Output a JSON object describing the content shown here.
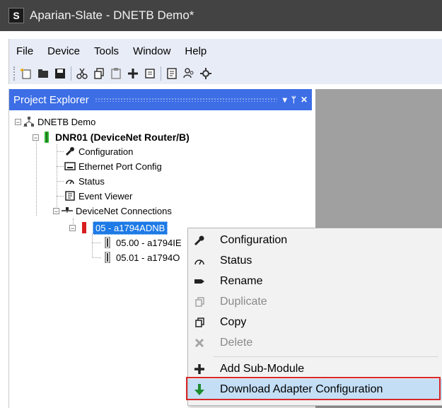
{
  "window": {
    "title": "Aparian-Slate  - DNETB Demo*",
    "icon_letter": "S"
  },
  "menubar": {
    "items": [
      "File",
      "Device",
      "Tools",
      "Window",
      "Help"
    ]
  },
  "toolbar": {
    "icons": [
      "new-file-icon",
      "open-folder-icon",
      "save-icon",
      "cut-icon",
      "copy-icon",
      "paste-icon",
      "add-icon",
      "download-icon",
      "event-icon",
      "users-icon",
      "settings-icon"
    ]
  },
  "explorer": {
    "title": "Project Explorer",
    "pin_glyph": "▾ ᛘ ✕",
    "tree": {
      "root": "DNETB Demo",
      "device": "DNR01 (DeviceNet Router/B)",
      "children": [
        "Configuration",
        "Ethernet Port Config",
        "Status",
        "Event Viewer",
        "DeviceNet Connections"
      ],
      "adapter": "05 - a1794ADNB",
      "modules": [
        "05.00 - a1794IE",
        "05.01 - a1794O"
      ]
    }
  },
  "context_menu": {
    "items": [
      {
        "label": "Configuration",
        "icon": "wrench-icon",
        "disabled": false
      },
      {
        "label": "Status",
        "icon": "status-icon",
        "disabled": false
      },
      {
        "label": "Rename",
        "icon": "rename-icon",
        "disabled": false
      },
      {
        "label": "Duplicate",
        "icon": "duplicate-icon",
        "disabled": true
      },
      {
        "label": "Copy",
        "icon": "copy-icon",
        "disabled": false
      },
      {
        "label": "Delete",
        "icon": "delete-icon",
        "disabled": true
      },
      {
        "label": "Add Sub-Module",
        "icon": "plus-icon",
        "disabled": false
      },
      {
        "label": "Download Adapter Configuration",
        "icon": "download-arrow-icon",
        "disabled": false
      }
    ]
  },
  "colors": {
    "titlebar": "#434343",
    "menubar": "#e8ecf6",
    "explorer_header": "#3d6ee6",
    "selection": "#1d7ae6",
    "highlight": "#c3def5",
    "outline": "#d82828"
  }
}
